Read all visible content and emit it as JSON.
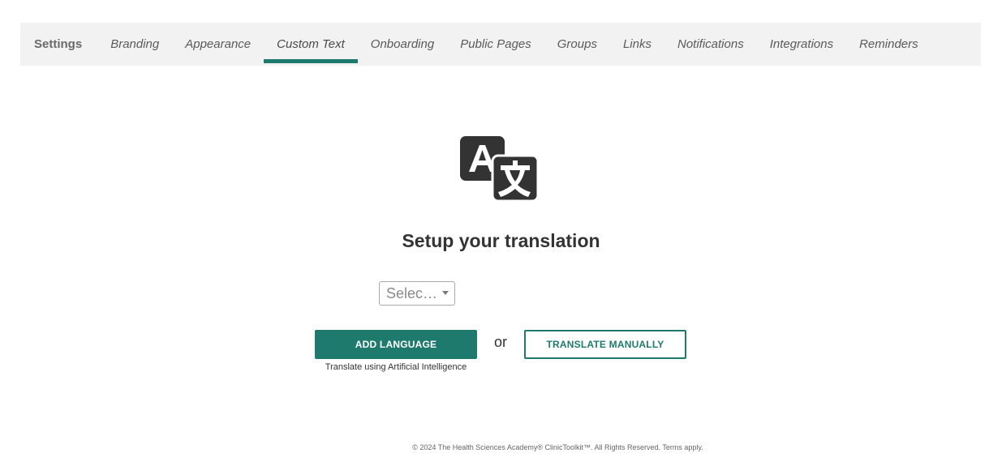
{
  "tabs": [
    {
      "label": "Settings",
      "active": false
    },
    {
      "label": "Branding",
      "active": false
    },
    {
      "label": "Appearance",
      "active": false
    },
    {
      "label": "Custom Text",
      "active": true
    },
    {
      "label": "Onboarding",
      "active": false
    },
    {
      "label": "Public Pages",
      "active": false
    },
    {
      "label": "Groups",
      "active": false
    },
    {
      "label": "Links",
      "active": false
    },
    {
      "label": "Notifications",
      "active": false
    },
    {
      "label": "Integrations",
      "active": false
    },
    {
      "label": "Reminders",
      "active": false
    }
  ],
  "hero": {
    "icon": "translate-icon",
    "title": "Setup your translation"
  },
  "language_select": {
    "selected": "Selec…"
  },
  "actions": {
    "add_language_label": "ADD LANGUAGE",
    "add_language_hint": "Translate using Artificial Intelligence",
    "or_label": "or",
    "translate_manually_label": "TRANSLATE MANUALLY"
  },
  "footer": {
    "text": "© 2024 The Health Sciences Academy® ClinicToolkit™. All Rights Reserved. Terms apply."
  },
  "colors": {
    "accent": "#1f7a6e",
    "tabbar_bg": "#f2f2f2",
    "icon_dark": "#333333"
  }
}
